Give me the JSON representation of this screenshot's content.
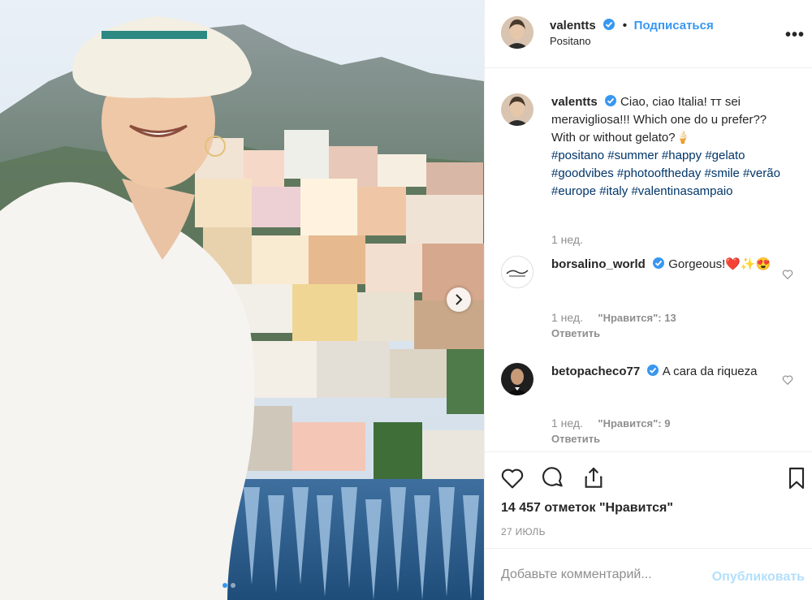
{
  "header": {
    "username": "valentts",
    "follow_label": "Подписаться",
    "location": "Positano",
    "more_label": "•••"
  },
  "caption": {
    "username": "valentts",
    "text": "Ciao, ciao Italia! ᴛᴛ sei meravigliosa!!! Which one do u prefer?? With or without gelato?🍦",
    "hashtags": [
      "#positano",
      "#summer",
      "#happy",
      "#gelato",
      "#goodvibes",
      "#photooftheday",
      "#smile",
      "#verão",
      "#europe",
      "#italy",
      "#valentinasampaio"
    ],
    "time": "1 нед."
  },
  "comments": [
    {
      "username": "borsalino_world",
      "text": "Gorgeous!❤️✨😍",
      "time": "1 нед.",
      "likes": "\"Нравится\": 13",
      "reply": "Ответить"
    },
    {
      "username": "betopacheco77",
      "text": "A cara da riqueza",
      "time": "1 нед.",
      "likes": "\"Нравится\": 9",
      "reply": "Ответить"
    }
  ],
  "actions": {
    "likes": "14 457 отметок \"Нравится\"",
    "date": "27 ИЮЛЬ"
  },
  "add_comment": {
    "placeholder": "Добавьте комментарий...",
    "publish": "Опубликовать"
  },
  "colors": {
    "link_blue": "#3897f0",
    "hashtag": "#003569",
    "meta_gray": "#8e8e8e",
    "publish_disabled": "#b2dffc"
  },
  "icons": [
    "verified-icon",
    "more-icon",
    "heart-icon",
    "comment-icon",
    "share-icon",
    "bookmark-icon",
    "chevron-right-icon"
  ]
}
